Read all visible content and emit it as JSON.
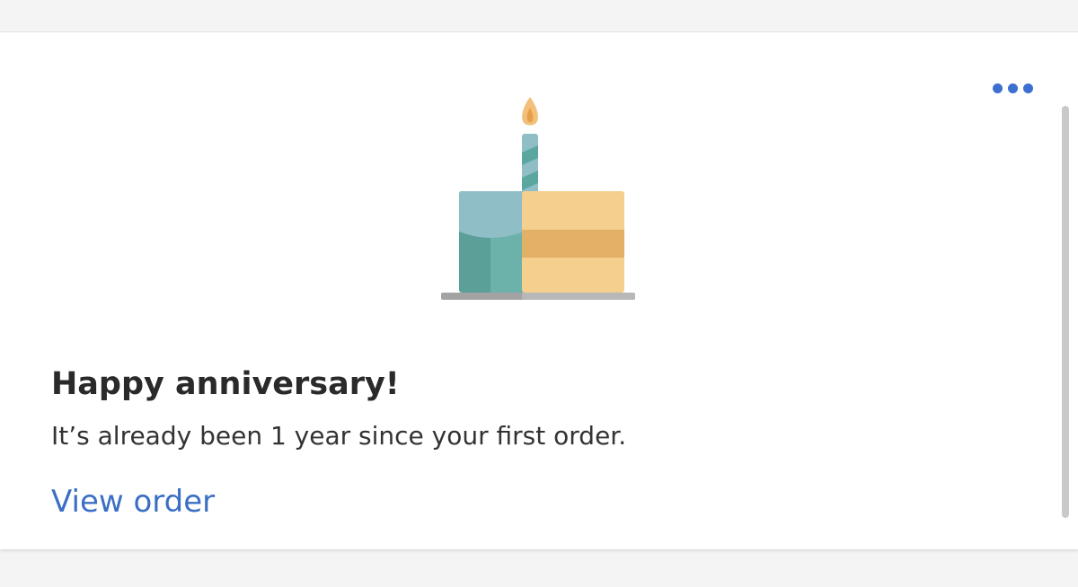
{
  "card": {
    "title": "Happy anniversary!",
    "message": "It’s already been 1 year since your first order.",
    "link_label": "View order"
  },
  "icons": {
    "menu": "more-horizontal-icon",
    "illustration": "birthday-cake-icon"
  },
  "colors": {
    "accent": "#3a6fc4",
    "menu_dots": "#3c6fd0",
    "cake_teal": "#5ba7a0",
    "cake_frosting": "#8fbec7",
    "cake_sponge": "#f5cf8e",
    "cake_filling": "#e2b066",
    "flame": "#e6a84a"
  }
}
